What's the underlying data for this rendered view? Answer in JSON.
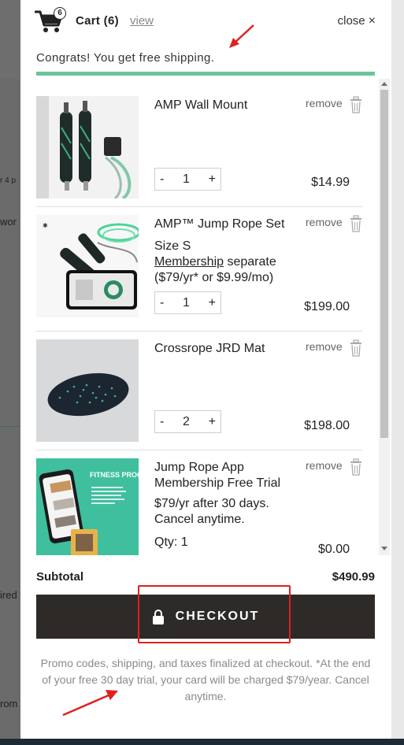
{
  "background": {
    "fragments": [
      "r 4 p",
      "wor",
      "ired",
      "rom"
    ]
  },
  "header": {
    "badge_count": "6",
    "title": "Cart (6)",
    "view_link": "view",
    "close_label": "close",
    "close_glyph": "×",
    "free_shipping_msg": "Congrats! You get free shipping."
  },
  "items": [
    {
      "name": "AMP Wall Mount",
      "remove_label": "remove",
      "quantity": "1",
      "price": "$14.99"
    },
    {
      "name": "AMP™ Jump Rope Set",
      "size": "Size S",
      "membership_link": "Membership",
      "membership_rest": " separate",
      "membership_price": "($79/yr* or $9.99/mo)",
      "remove_label": "remove",
      "quantity": "1",
      "price": "$199.00"
    },
    {
      "name": "Crossrope JRD Mat",
      "remove_label": "remove",
      "quantity": "2",
      "price": "$198.00"
    },
    {
      "name": "Jump Rope App Membership Free Trial",
      "detail": "$79/yr after 30 days. Cancel anytime.",
      "qty_label": "Qty: 1",
      "remove_label": "remove",
      "price": "$0.00",
      "image_text": "FITNESS PROGRAMS"
    }
  ],
  "qty_controls": {
    "minus": "-",
    "plus": "+"
  },
  "footer": {
    "subtotal_label": "Subtotal",
    "subtotal_value": "$490.99",
    "checkout_label": "CHECKOUT",
    "note": "Promo codes, shipping, and taxes finalized at checkout. *At the end of your free 30 day trial, your card will be charged $79/year. Cancel anytime."
  },
  "colors": {
    "progress": "#6cc49a",
    "checkout_bg": "#2e2a28",
    "annotation": "#e02020"
  }
}
